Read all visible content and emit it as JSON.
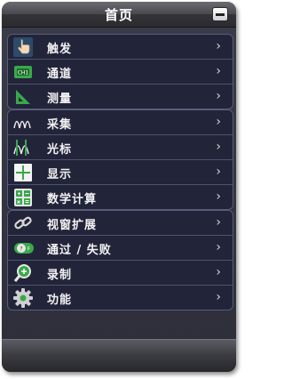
{
  "header": {
    "title": "首页"
  },
  "groups": [
    {
      "items": [
        {
          "label": "触发",
          "icon": "touch-hand-icon"
        },
        {
          "label": "通道",
          "icon": "channel-chip-icon"
        },
        {
          "label": "测量",
          "icon": "ruler-triangle-icon"
        }
      ]
    },
    {
      "items": [
        {
          "label": "采集",
          "icon": "waveform-icon"
        },
        {
          "label": "光标",
          "icon": "cursor-wave-icon"
        },
        {
          "label": "显示",
          "icon": "crosshair-display-icon"
        },
        {
          "label": "数学计算",
          "icon": "calculator-icon"
        }
      ]
    },
    {
      "items": [
        {
          "label": "视窗扩展",
          "icon": "link-chain-icon"
        },
        {
          "label": "通过 / 失败",
          "icon": "pass-fail-toggle-icon"
        },
        {
          "label": "录制",
          "icon": "record-magnifier-icon"
        },
        {
          "label": "功能",
          "icon": "gear-icon"
        }
      ]
    }
  ],
  "chevron": "›",
  "colors": {
    "panel": "#22243a",
    "border": "#5a5c78",
    "accent_green": "#3aa84a"
  }
}
